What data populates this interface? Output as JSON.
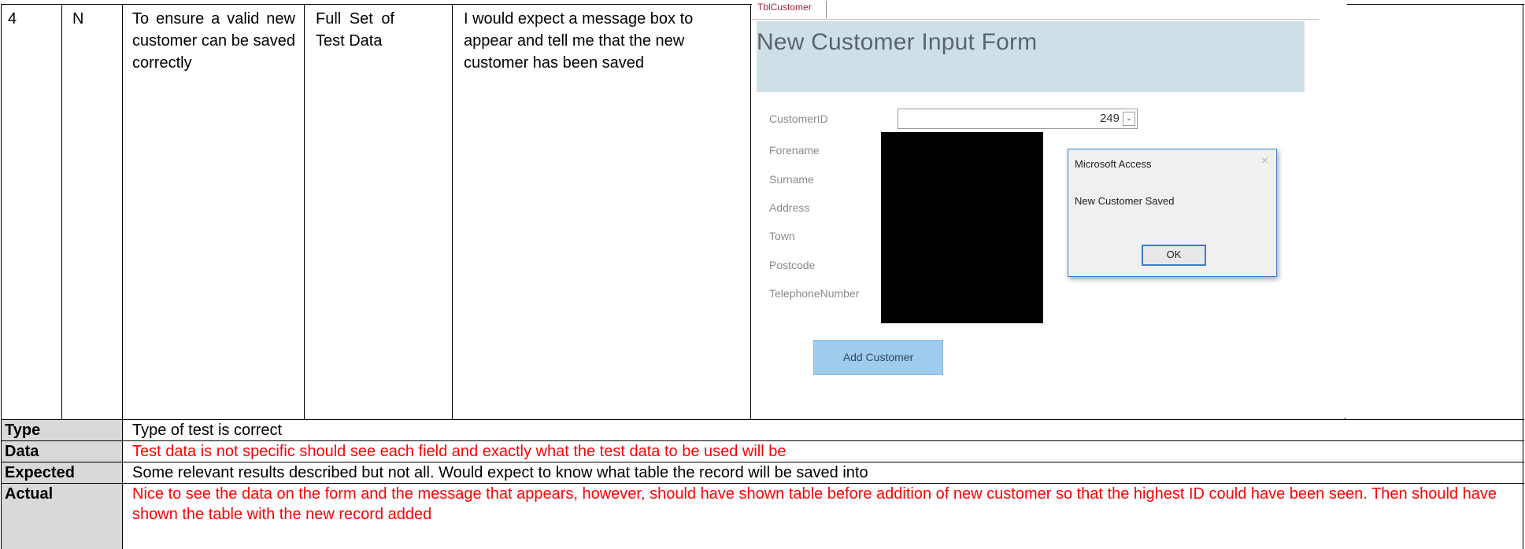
{
  "row": {
    "number": "4",
    "type_code": "N",
    "purpose": "To ensure a valid new customer can be saved correctly",
    "test_data": "Full Set of Test Data",
    "expected": "I would expect a message box to appear and tell me that the new customer has been saved"
  },
  "screenshot": {
    "tab_label": "TblCustomer",
    "form_title": "New Customer Input Form",
    "fields": [
      "CustomerID",
      "Forename",
      "Surname",
      "Address",
      "Town",
      "Postcode",
      "TelephoneNumber"
    ],
    "customer_id_value": "249",
    "dialog": {
      "title": "Microsoft Access",
      "message": "New Customer Saved",
      "ok_label": "OK",
      "close_glyph": "×"
    },
    "add_button_label": "Add Customer",
    "dropdown_glyph": "⌄"
  },
  "feedback": [
    {
      "label": "Type",
      "text": "Type of test is correct",
      "color": "#000000"
    },
    {
      "label": "Data",
      "text": "Test data is not specific should see each field and exactly what the test data to be used will be",
      "color": "#ff0000"
    },
    {
      "label": "Expected",
      "text": "Some relevant results described but not all. Would expect to know what table the record will be saved into",
      "color": "#000000"
    },
    {
      "label": "Actual",
      "text": "Nice to see the data on the form and the message that appears, however, should have shown table before addition of new customer so that the highest ID could have been seen.  Then should have shown the table with the new record added",
      "color": "#ff0000"
    }
  ]
}
